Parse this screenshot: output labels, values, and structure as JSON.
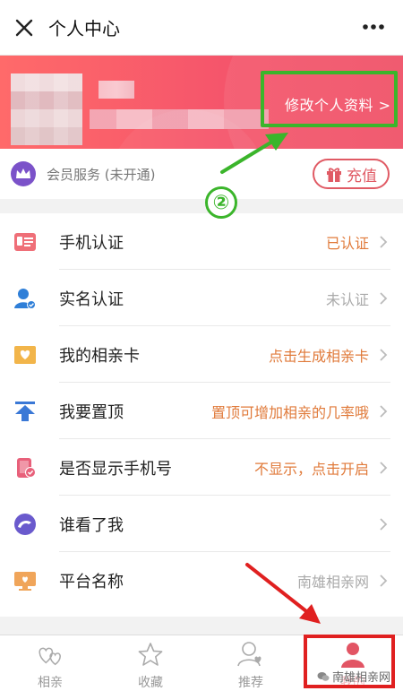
{
  "topbar": {
    "title": "个人中心"
  },
  "profile": {
    "edit_label": "修改个人资料 >"
  },
  "vip": {
    "text": "会员服务 (未开通)",
    "recharge_label": "充值"
  },
  "annotation": {
    "step": "②"
  },
  "menu": [
    {
      "label": "手机认证",
      "value": "已认证",
      "value_color": "#e07a3a",
      "icon": "phone-card-icon"
    },
    {
      "label": "实名认证",
      "value": "未认证",
      "value_color": "#aaaaaa",
      "icon": "user-verified-icon"
    },
    {
      "label": "我的相亲卡",
      "value": "点击生成相亲卡",
      "value_color": "#e07a3a",
      "icon": "heart-card-icon"
    },
    {
      "label": "我要置顶",
      "value": "置顶可增加相亲的几率哦",
      "value_color": "#e07a3a",
      "icon": "top-arrow-icon"
    },
    {
      "label": "是否显示手机号",
      "value": "不显示，点击开启",
      "value_color": "#e07a3a",
      "icon": "phone-visibility-icon"
    },
    {
      "label": "谁看了我",
      "value": "",
      "value_color": "#aaaaaa",
      "icon": "visitors-icon"
    },
    {
      "label": "平台名称",
      "value": "南雄相亲网",
      "value_color": "#aaaaaa",
      "icon": "platform-icon"
    }
  ],
  "tabs": [
    {
      "label": "相亲",
      "icon": "hearts-icon",
      "active": false
    },
    {
      "label": "收藏",
      "icon": "star-icon",
      "active": false
    },
    {
      "label": "推荐",
      "icon": "recommend-user-icon",
      "active": false
    },
    {
      "label": "我的",
      "icon": "user-icon",
      "active": true
    }
  ],
  "watermark": {
    "text": "南雄相亲网"
  },
  "colors": {
    "brand": "#f0566b",
    "annotation_green": "#3bb52b",
    "annotation_red": "#e02020",
    "active_tab": "#e25564"
  }
}
